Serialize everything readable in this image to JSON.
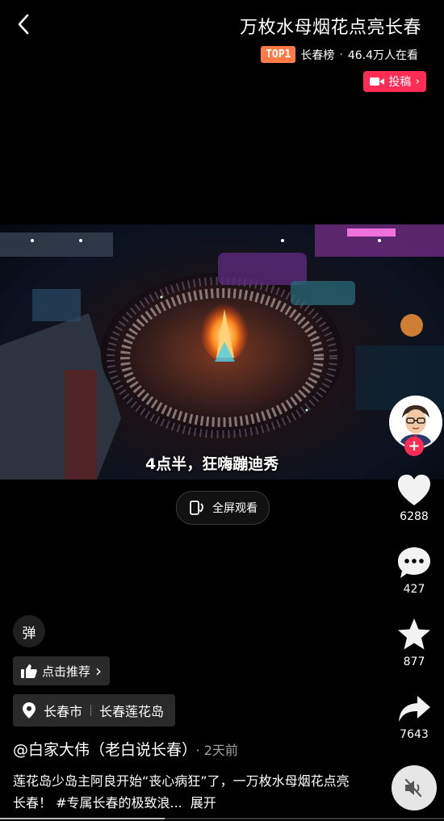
{
  "header": {
    "title": "万枚水母烟花点亮长春",
    "top_badge": "TOP1",
    "board_name": "长春榜",
    "separator": "·",
    "viewers": "46.4万人在看",
    "post_label": "投稿",
    "post_chevron": "›"
  },
  "video": {
    "caption": "4点半，狂嗨蹦迪秀"
  },
  "fullscreen": {
    "label": "全屏观看"
  },
  "rail": {
    "follow_symbol": "+",
    "likes": "6288",
    "comments": "427",
    "favorites": "877",
    "shares": "7643"
  },
  "bottom": {
    "danmu_label": "弹",
    "recommend_label": "点击推荐",
    "recommend_chevron": "›",
    "location_city": "长春市",
    "location_place": "长春莲花岛",
    "author": "@白家大伟（老白说长春）",
    "time": "· 2天前",
    "description": "莲花岛少岛主阿良开始“丧心病狂”了，一万枚水母烟花点亮长春！ #专属长春的极致浪...",
    "expand_label": "展开",
    "progress": 0.37
  },
  "colors": {
    "accent_red": "#ff2c55",
    "top_badge": "#ff7a45"
  },
  "icons": {
    "back": "chevron-left-icon",
    "post": "video-camera-icon",
    "fullscreen": "rotate-phone-icon",
    "like": "heart-icon",
    "comment": "speech-bubble-icon",
    "favorite": "star-icon",
    "share": "share-arrow-icon",
    "recommend": "thumbs-up-icon",
    "location": "location-pin-icon",
    "mute": "speaker-muted-icon"
  }
}
